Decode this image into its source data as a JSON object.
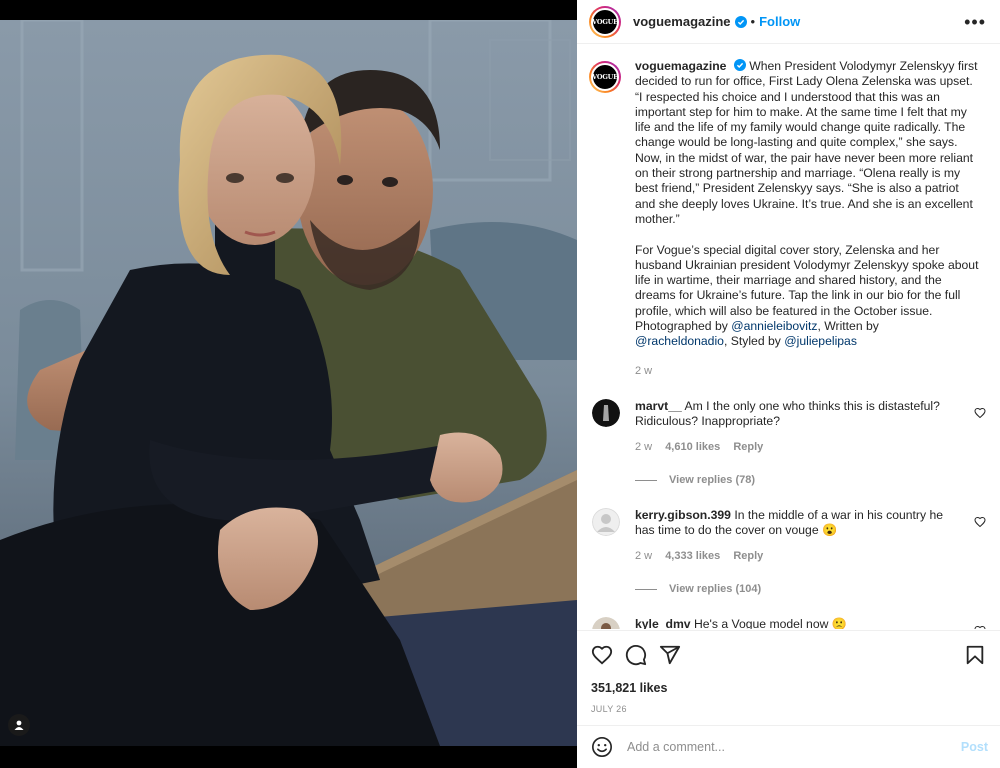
{
  "post": {
    "username": "voguemagazine",
    "avatar_text": "VOGUE",
    "follow_label": "Follow",
    "more_label": "•••",
    "dot": "•",
    "caption_text": "When President Volodymyr Zelenskyy first decided to run for office, First Lady Olena Zelenska was upset. “I respected his choice and I understood that this was an important step for him to make. At the same time I felt that my life and the life of my family would change quite radically. The change would be long-lasting and quite complex,” she says. Now, in the midst of war, the pair have never been more reliant on their strong partnership and marriage. “Olena really is my best friend,” President Zelenskyy says. “She is also a patriot and she deeply loves Ukraine. It’s true. And she is an excellent mother.”\n\nFor Vogue’s special digital cover story, Zelenska and her husband Ukrainian president Volodymyr Zelenskyy spoke about life in wartime, their marriage and shared history, and the dreams for Ukraine’s future. Tap the link in our bio for the full profile, which will also be featured in the October issue. Photographed by ",
    "credit_photographer": "@annieleibovitz",
    "credit_sep1": ", Written by",
    "credit_writer": "@racheldonadio",
    "credit_sep2": ", Styled by ",
    "credit_stylist": "@juliepelipas",
    "caption_time": "2 w",
    "likes": "351,821 likes",
    "date": "JULY 26"
  },
  "comments": [
    {
      "username": "marvt__",
      "text": "Am I the only one who thinks this is distasteful? Ridiculous? Inappropriate?",
      "time": "2 w",
      "likes": "4,610 likes",
      "reply_label": "Reply",
      "view_replies": "View replies (78)"
    },
    {
      "username": "kerry.gibson.399",
      "text": "In the middle of a war in his country he has time to do the cover on vouge 😮",
      "time": "2 w",
      "likes": "4,333 likes",
      "reply_label": "Reply",
      "view_replies": "View replies (104)"
    },
    {
      "username": "kyle_dmv",
      "text": "He's a Vogue model now 🙁"
    }
  ],
  "add_comment": {
    "placeholder": "Add a comment...",
    "post_label": "Post"
  },
  "colors": {
    "accent": "#0095f6",
    "link": "#00376b",
    "muted": "#8e8e8e",
    "post_disabled": "#b2dffc"
  },
  "icons": {
    "like": "heart-icon",
    "comment": "comment-icon",
    "share": "share-icon",
    "save": "bookmark-icon",
    "emoji": "emoji-icon",
    "tag": "user-tag-icon",
    "verified": "verified-badge-icon"
  }
}
